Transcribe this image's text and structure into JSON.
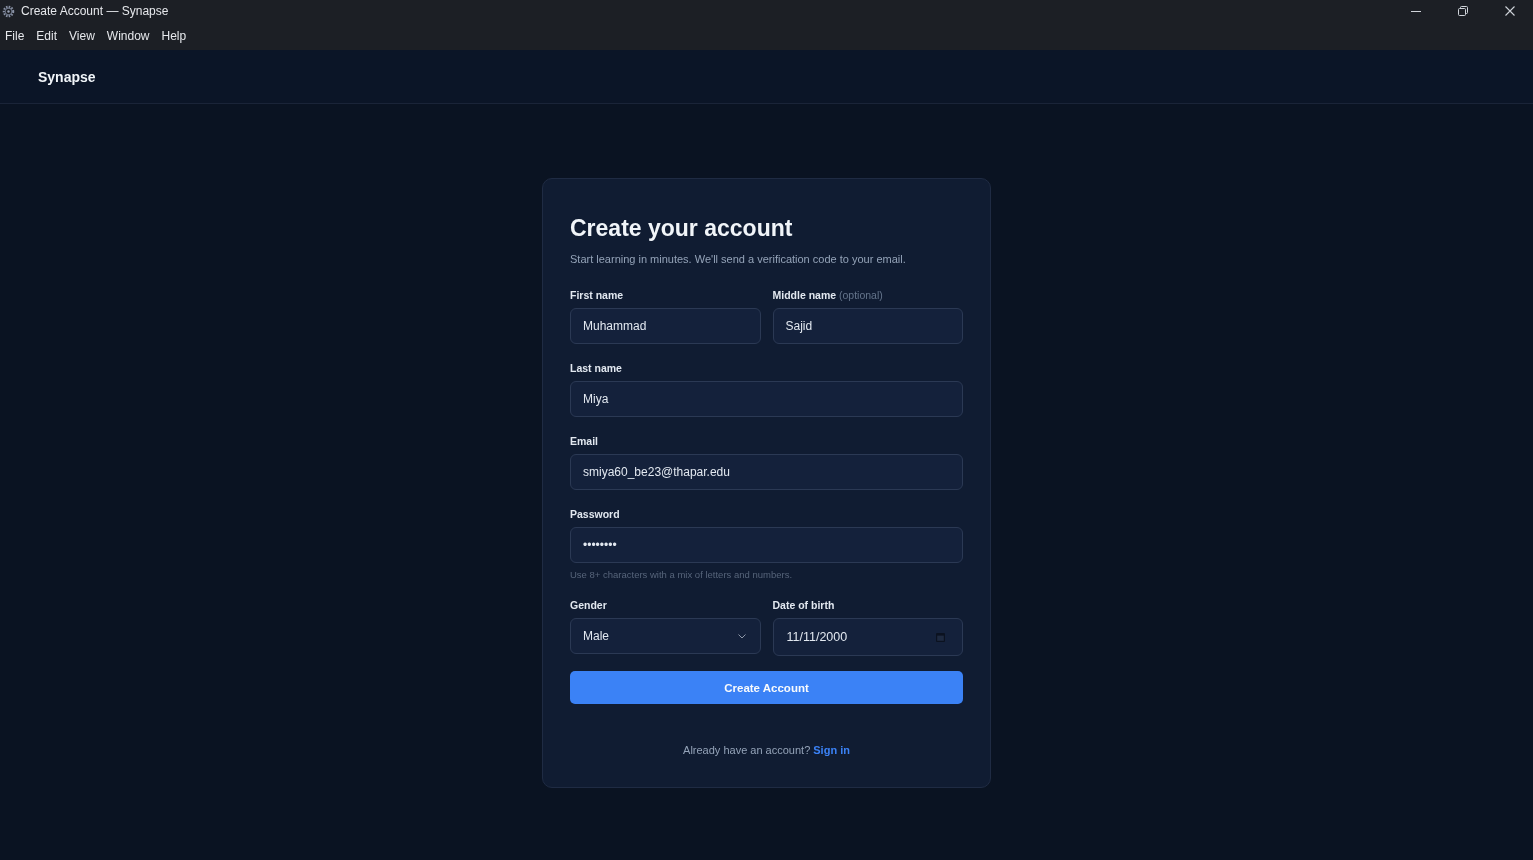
{
  "window": {
    "title": "Create Account — Synapse"
  },
  "menu": [
    "File",
    "Edit",
    "View",
    "Window",
    "Help"
  ],
  "app_header": {
    "brand": "Synapse"
  },
  "form": {
    "title": "Create your account",
    "subtitle": "Start learning in minutes. We'll send a verification code to your email.",
    "rows": [
      [
        {
          "kind": "text",
          "label": "First name",
          "value": "Muhammad"
        },
        {
          "kind": "text",
          "label": "Middle name",
          "note": "(optional)",
          "value": "Sajid"
        }
      ],
      [
        {
          "kind": "text",
          "label": "Last name",
          "value": "Miya"
        }
      ],
      [
        {
          "kind": "text",
          "label": "Email",
          "value": "smiya60_be23@thapar.edu"
        }
      ],
      [
        {
          "kind": "password",
          "label": "Password",
          "value": "••••••••",
          "hint": "Use 8+ characters with a mix of letters and numbers."
        }
      ],
      [
        {
          "kind": "select",
          "label": "Gender",
          "value": "Male"
        },
        {
          "kind": "date",
          "label": "Date of birth",
          "value": "11/11/2000"
        }
      ]
    ],
    "submit": "Create Account",
    "footer": {
      "text": "Already have an account?",
      "link": "Sign in"
    }
  }
}
